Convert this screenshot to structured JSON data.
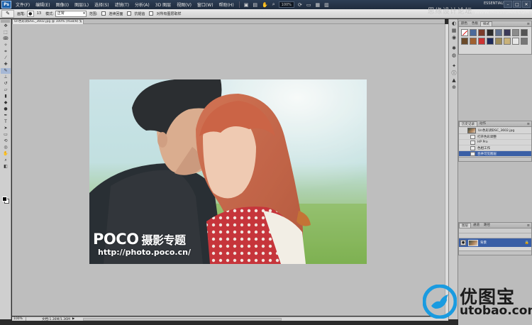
{
  "app": {
    "logo": "Ps"
  },
  "menubar": {
    "items": [
      "文件(F)",
      "编辑(E)",
      "图像(I)",
      "图层(L)",
      "选择(S)",
      "滤镜(T)",
      "分析(A)",
      "3D 图层",
      "视图(V)",
      "窗口(W)",
      "帮助(H)"
    ],
    "zoom": "100%",
    "workspace": "ESSENTIALS ▾",
    "window_controls": [
      "–",
      "□",
      "✕"
    ]
  },
  "options": {
    "brush_label": "画笔:",
    "brush_size": "13",
    "mode_label": "模式:",
    "mode_value": "正常",
    "range_label": "范围:",
    "opt1": "连续回面",
    "opt2": "抗锯齿",
    "opt3": "对所有图层取样"
  },
  "top_watermark": {
    "cn": "思缘设计论坛",
    "en": "WWW.MISSYUAN.COM"
  },
  "document": {
    "tab_title": "Un色彩调DSC_3602.jpg @ 100% (RGB/8) *",
    "tab_close": "×",
    "photo_watermark_logo": "POCO",
    "photo_watermark_cn": "摄影专题",
    "photo_watermark_url": "http://photo.poco.cn/"
  },
  "status": {
    "zoom": "100%",
    "doc_info": "文档:1.36M/1.36M",
    "arrow": "▶"
  },
  "panels": {
    "styles": {
      "tabs": [
        "颜色",
        "色板",
        "样式"
      ],
      "active": 2
    },
    "history": {
      "tabs": [
        "历史记录",
        "动作"
      ],
      "snapshot": "Un色彩调DSC_3602.jpg",
      "steps": [
        "打开色彩调整",
        "HP Pro",
        "色相工作",
        "合并可见图层"
      ],
      "selected_index": 3
    },
    "layers": {
      "tabs": [
        "图层",
        "通道",
        "路径"
      ],
      "layer_name": "背景",
      "eye": "●",
      "lock": "🔒"
    },
    "menu": "≡"
  },
  "brand_watermark": {
    "cn": "优图宝",
    "en": "utobao.com"
  },
  "colors": {
    "menubar": "#1f2c3e",
    "canvas_bg": "#bebebe",
    "selection": "#3a5fa6",
    "brand_blue": "#1a9be0"
  }
}
